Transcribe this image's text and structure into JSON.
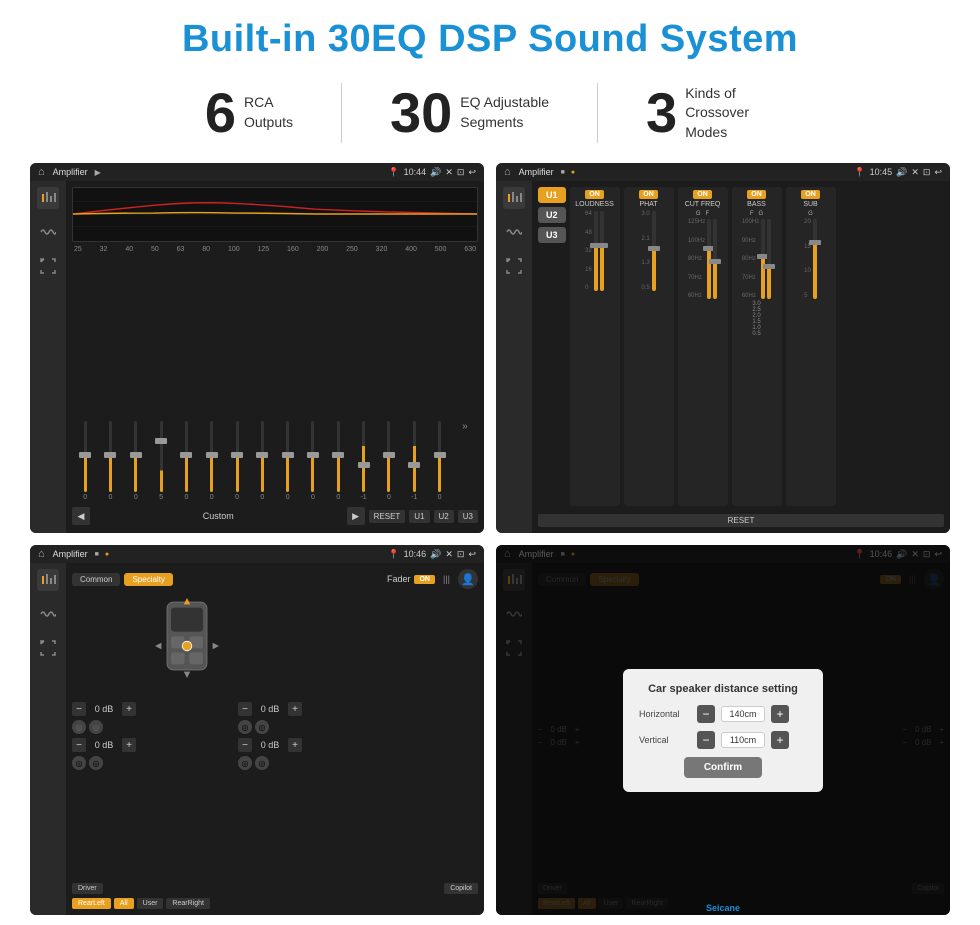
{
  "title": "Built-in 30EQ DSP Sound System",
  "stats": [
    {
      "number": "6",
      "desc_line1": "RCA",
      "desc_line2": "Outputs"
    },
    {
      "number": "30",
      "desc_line1": "EQ Adjustable",
      "desc_line2": "Segments"
    },
    {
      "number": "3",
      "desc_line1": "Kinds of",
      "desc_line2": "Crossover Modes"
    }
  ],
  "screen1": {
    "title": "Amplifier",
    "time": "10:44",
    "eq_freqs": [
      "25",
      "32",
      "40",
      "50",
      "63",
      "80",
      "100",
      "125",
      "160",
      "200",
      "250",
      "320",
      "400",
      "500",
      "630"
    ],
    "eq_values": [
      "0",
      "0",
      "0",
      "5",
      "0",
      "0",
      "0",
      "0",
      "0",
      "0",
      "0",
      "-1",
      "0",
      "-1",
      "0"
    ],
    "eq_thumbs": [
      50,
      50,
      50,
      30,
      50,
      50,
      50,
      50,
      50,
      50,
      50,
      65,
      50,
      65,
      50
    ],
    "bottom_label": "Custom",
    "bottom_buttons": [
      "RESET",
      "U1",
      "U2",
      "U3"
    ]
  },
  "screen2": {
    "title": "Amplifier",
    "time": "10:45",
    "channels": [
      "U1",
      "U2",
      "U3"
    ],
    "strips": [
      {
        "label": "LOUDNESS",
        "on": true
      },
      {
        "label": "PHAT",
        "on": true
      },
      {
        "label": "CUT FREQ",
        "on": true
      },
      {
        "label": "BASS",
        "on": true
      },
      {
        "label": "SUB",
        "on": true
      }
    ],
    "reset_label": "RESET"
  },
  "screen3": {
    "title": "Amplifier",
    "time": "10:46",
    "tabs": [
      "Common",
      "Specialty"
    ],
    "fader_label": "Fader",
    "on_label": "ON",
    "volumes": [
      {
        "label": "0 dB"
      },
      {
        "label": "0 dB"
      },
      {
        "label": "0 dB"
      },
      {
        "label": "0 dB"
      }
    ],
    "presets": [
      "Driver",
      "RearLeft",
      "All",
      "User",
      "RearRight",
      "Copilot"
    ]
  },
  "screen4": {
    "title": "Amplifier",
    "time": "10:46",
    "tabs": [
      "Common",
      "Specialty"
    ],
    "on_label": "ON",
    "dialog": {
      "title": "Car speaker distance setting",
      "horizontal_label": "Horizontal",
      "horizontal_value": "140cm",
      "vertical_label": "Vertical",
      "vertical_value": "110cm",
      "confirm_label": "Confirm"
    },
    "presets": [
      "Driver",
      "RearLeft",
      "All",
      "User",
      "RearRight",
      "Copilot"
    ]
  },
  "watermark": "Seicane"
}
